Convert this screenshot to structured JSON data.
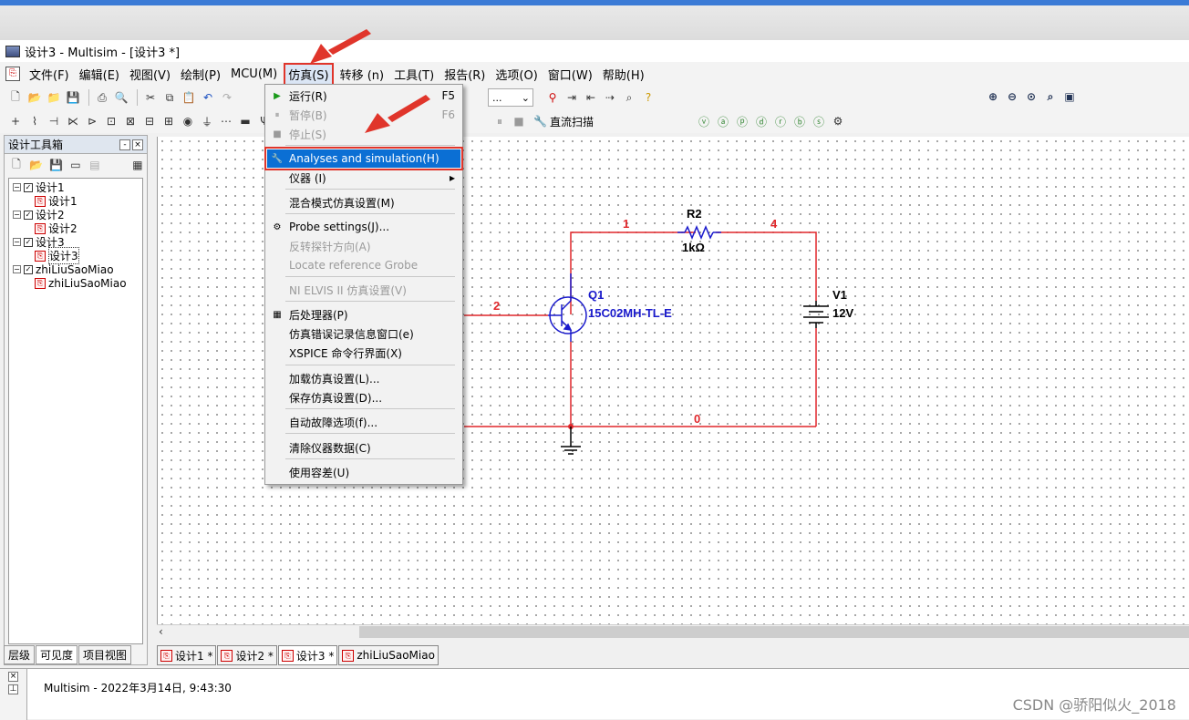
{
  "window": {
    "title": "设计3 - Multisim - [设计3 *]"
  },
  "menubar": {
    "items": [
      "文件(F)",
      "编辑(E)",
      "视图(V)",
      "绘制(P)",
      "MCU(M)",
      "仿真(S)",
      "转移 (n)",
      "工具(T)",
      "报告(R)",
      "选项(O)",
      "窗口(W)",
      "帮助(H)"
    ],
    "active": "仿真(S)"
  },
  "toolbar": {
    "combo_value": "...",
    "sweep_label": "直流扫描"
  },
  "toolbox": {
    "title": "设计工具箱",
    "tree": [
      {
        "label": "设计1",
        "child": "设计1"
      },
      {
        "label": "设计2",
        "child": "设计2"
      },
      {
        "label": "设计3",
        "child": "设计3"
      },
      {
        "label": "zhiLiuSaoMiao",
        "child": "zhiLiuSaoMiao"
      }
    ],
    "tabs": [
      "层级",
      "可见度",
      "项目视图"
    ]
  },
  "sim_menu": {
    "run": {
      "label": "运行(R)",
      "shortcut": "F5"
    },
    "pause": {
      "label": "暂停(B)",
      "shortcut": "F6"
    },
    "stop": {
      "label": "停止(S)"
    },
    "analyses": {
      "label": "Analyses and simulation(H)"
    },
    "instruments": {
      "label": "仪器 (I)"
    },
    "mixed_mode": {
      "label": "混合模式仿真设置(M)"
    },
    "probe_settings": {
      "label": "Probe settings(J)..."
    },
    "reverse_probe": {
      "label": "反转探针方向(A)"
    },
    "locate_ref": {
      "label": "Locate reference Grobe"
    },
    "ni_elvis": {
      "label": "NI ELVIS II 仿真设置(V)"
    },
    "postprocessor": {
      "label": "后处理器(P)"
    },
    "error_log": {
      "label": "仿真错误记录信息窗口(e)"
    },
    "xspice": {
      "label": "XSPICE 命令行界面(X)"
    },
    "load_settings": {
      "label": "加载仿真设置(L)..."
    },
    "save_settings": {
      "label": "保存仿真设置(D)..."
    },
    "auto_fault": {
      "label": "自动故障选项(f)..."
    },
    "clear_data": {
      "label": "清除仪器数据(C)"
    },
    "tolerance": {
      "label": "使用容差(U)"
    }
  },
  "schematic": {
    "r2_name": "R2",
    "r2_value": "1kΩ",
    "q1_name": "Q1",
    "q1_model": "15C02MH-TL-E",
    "v1_name": "V1",
    "v1_value": "12V",
    "node1": "1",
    "node2": "2",
    "node4": "4",
    "node0": "0",
    "wire_color": "#e0262a",
    "part_color": "#1a1acc"
  },
  "design_tabs": [
    "设计1 *",
    "设计2 *",
    "设计3 *",
    "zhiLiuSaoMiao"
  ],
  "output": {
    "message": "Multisim  -  2022年3月14日, 9:43:30"
  },
  "watermark": "CSDN @骄阳似火_2018",
  "colors": {
    "highlight": "#0b6fd4",
    "annotation_red": "#e0352b"
  }
}
